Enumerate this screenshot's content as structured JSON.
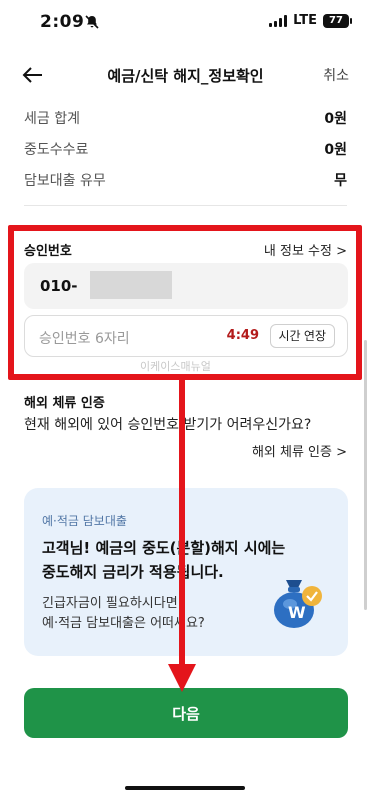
{
  "status_bar": {
    "time": "2:09",
    "network": "LTE",
    "battery": "77"
  },
  "header": {
    "title": "예금/신탁 해지_정보확인",
    "cancel": "취소"
  },
  "info_rows": [
    {
      "label": "세금 합계",
      "value": "0원"
    },
    {
      "label": "중도수수료",
      "value": "0원"
    },
    {
      "label": "담보대출 유무",
      "value": "무"
    }
  ],
  "auth": {
    "label": "승인번호",
    "edit_link": "내 정보 수정 >",
    "phone_value": "010-",
    "code_placeholder": "승인번호 6자리",
    "timer": "4:49",
    "extend_button": "시간 연장"
  },
  "watermark": "이케이스매뉴얼",
  "overseas": {
    "label": "해외 체류 인증",
    "text": "현재 해외에 있어 승인번호 받기가 어려우신가요?",
    "link": "해외 체류 인증 >"
  },
  "promo": {
    "tag": "예·적금 담보대출",
    "headline_line1": "고객님! 예금의 중도(분할)해지 시에는",
    "headline_line2": "중도해지 금리가 적용됩니다.",
    "body_line1": "긴급자금이 필요하시다면",
    "body_line2": "예·적금 담보대출은 어떠세요?"
  },
  "next_button": "다음",
  "colors": {
    "accent_green": "#1f9348",
    "highlight_red": "#e4151b",
    "timer_red": "#b31b1b",
    "promo_bg": "#e8f1fb"
  }
}
